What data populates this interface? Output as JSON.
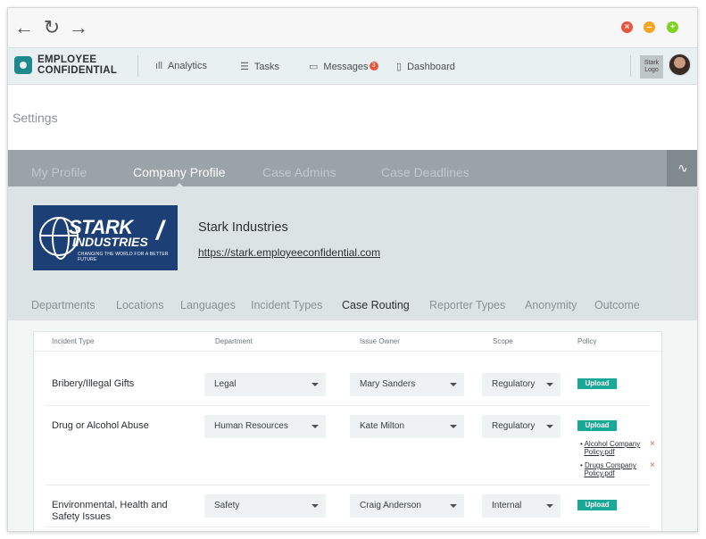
{
  "browser": {
    "back": "←",
    "reload": "↻",
    "forward": "→",
    "close": "×",
    "minimize": "–",
    "maximize": "+"
  },
  "header": {
    "logo_line1": "EMPLOYEE",
    "logo_line2": "CONFIDENTIAL",
    "nav": [
      {
        "label": "Analytics",
        "icon": "bar-chart-icon"
      },
      {
        "label": "Tasks",
        "icon": "list-icon"
      },
      {
        "label": "Messages",
        "icon": "message-icon",
        "badge": "3"
      },
      {
        "label": "Dashboard",
        "icon": "clipboard-icon"
      }
    ],
    "company_logo_text": "Stark Logo"
  },
  "page": {
    "title": "Settings"
  },
  "profile_tabs": [
    "My Profile",
    "Company Profile",
    "Case Admins",
    "Case Deadlines"
  ],
  "active_profile_tab": "Company Profile",
  "company": {
    "name": "Stark Industries",
    "url": "https://stark.employeeconfidential.com",
    "logo_word1": "STARK",
    "logo_word2": "INDUSTRIES",
    "logo_tagline": "CHANGING THE WORLD FOR A BETTER FUTURE"
  },
  "sub_tabs": [
    "Departments",
    "Locations",
    "Languages",
    "Incident Types",
    "Case Routing",
    "Reporter Types",
    "Anonymity",
    "Outcome"
  ],
  "active_sub_tab": "Case Routing",
  "table": {
    "headers": [
      "Incident Type",
      "Department",
      "Issue Owner",
      "Scope",
      "Policy"
    ],
    "upload_label": "Upload",
    "rows": [
      {
        "incident": "Bribery/Illegal Gifts",
        "department": "Legal",
        "owner": "Mary Sanders",
        "scope": "Regulatory",
        "files": []
      },
      {
        "incident": "Drug or Alcohol Abuse",
        "department": "Human Resources",
        "owner": "Kate Milton",
        "scope": "Regulatory",
        "files": [
          {
            "line1": "Alcohol Company",
            "line2": "Policy.pdf"
          },
          {
            "line1": "Drugs Company",
            "line2": "Policy.pdf"
          }
        ]
      },
      {
        "incident_line1": "Environmental, Health and",
        "incident_line2": "Safety Issues",
        "department": "Safety",
        "owner": "Craig Anderson",
        "scope": "Internal",
        "files": []
      }
    ]
  },
  "colors": {
    "accent": "#1aa899",
    "badge": "#e8553b",
    "tab_bar": "#9aa3a8",
    "logo_bg": "#1c3f76"
  }
}
